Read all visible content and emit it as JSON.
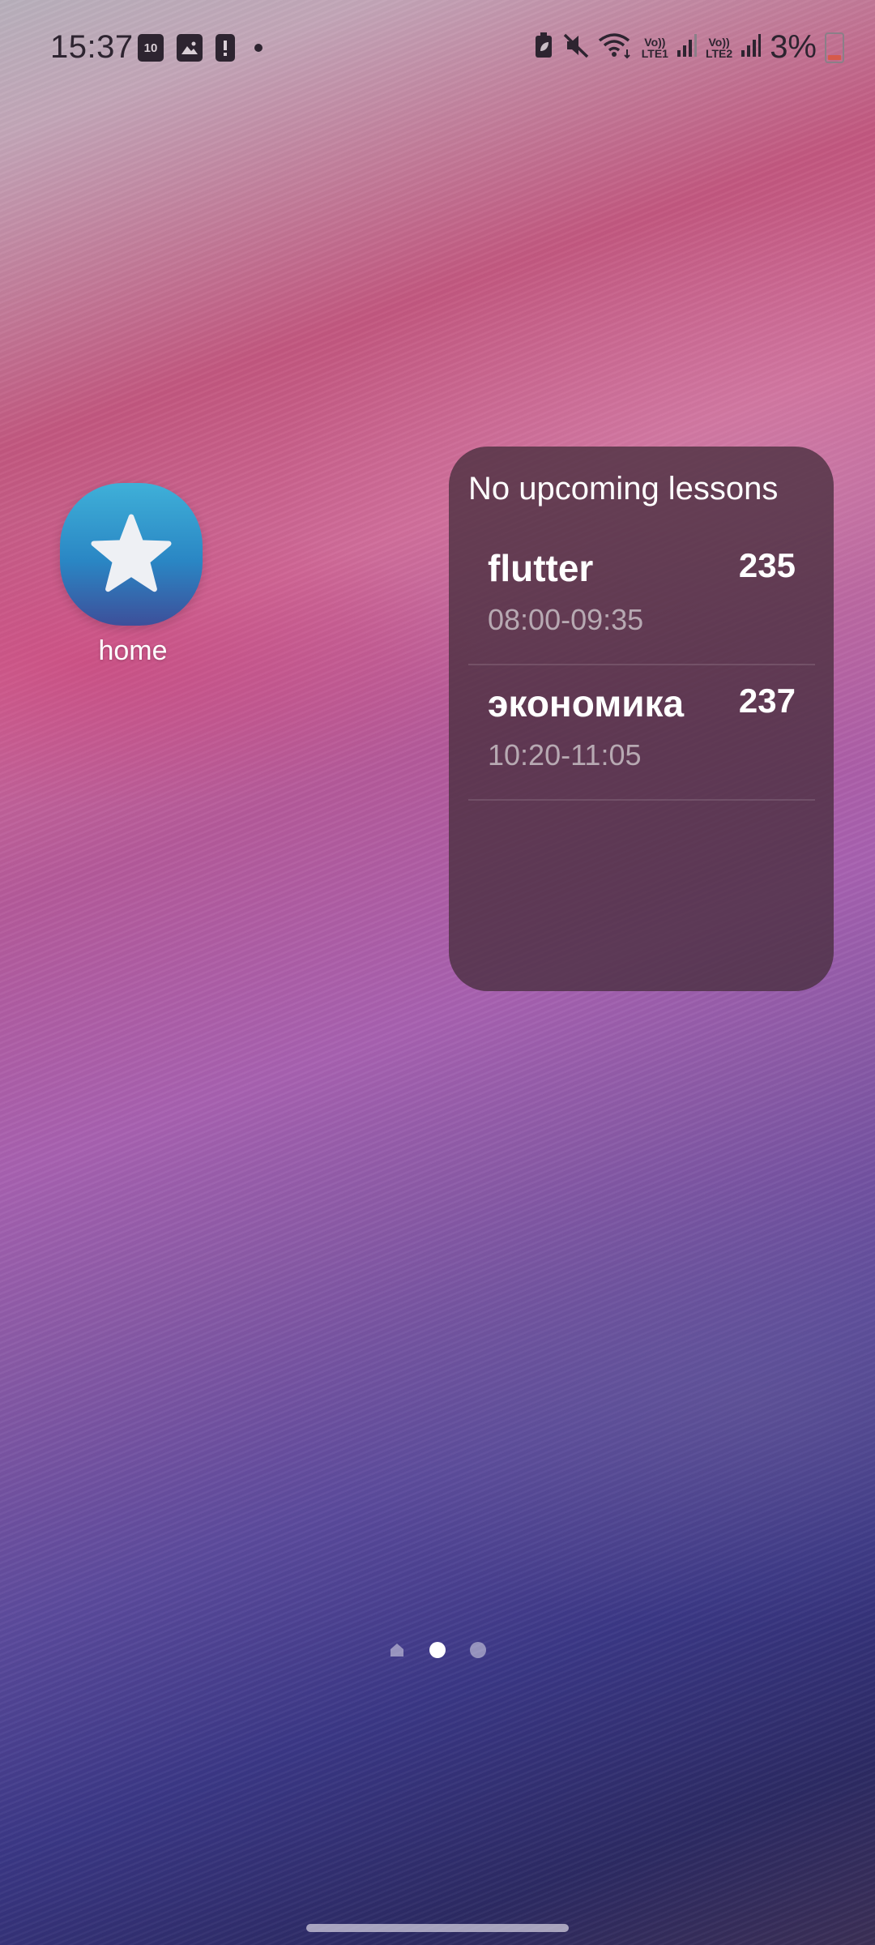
{
  "status_bar": {
    "time": "15:37",
    "calendar_day": "10",
    "battery_percent": "3%",
    "sim1_label_top": "Vo))",
    "sim1_label_bottom": "LTE1",
    "sim2_label_top": "Vo))",
    "sim2_label_bottom": "LTE2",
    "icons_left": [
      "calendar-icon",
      "gallery-icon",
      "alert-icon",
      "dot-icon"
    ],
    "icons_right": [
      "battery-saver-icon",
      "mute-icon",
      "wifi-icon",
      "signal-icon",
      "signal-icon",
      "battery-icon"
    ]
  },
  "home_app": {
    "label": "home",
    "icon": "star-icon",
    "colors": {
      "top": "#3fb0d8",
      "bottom": "#3d4f9a"
    }
  },
  "widget": {
    "title": "No upcoming lessons",
    "lessons": [
      {
        "name": "flutter",
        "time": "08:00-09:35",
        "room": "235"
      },
      {
        "name": "экономика",
        "time": "10:20-11:05",
        "room": "237"
      }
    ]
  },
  "page_indicator": {
    "pages": [
      "home-page-icon",
      "page-dot",
      "page-dot"
    ],
    "active_index": 1
  }
}
